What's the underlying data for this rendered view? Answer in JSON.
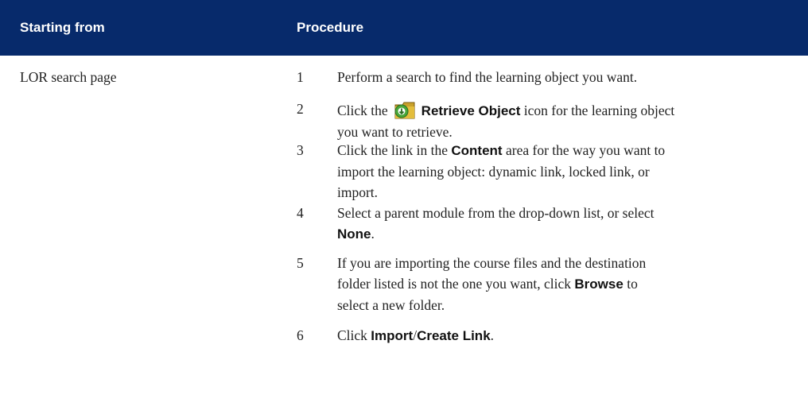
{
  "table": {
    "headers": {
      "starting_from": "Starting from",
      "procedure": "Procedure"
    },
    "row": {
      "starting_from": "LOR search page",
      "steps": [
        {
          "num": "1",
          "line1": "Perform a search to find the learning object you want."
        },
        {
          "num": "2",
          "pre": "Click the",
          "icon": "retrieve-object-icon",
          "ui": "Retrieve Object",
          "post": "icon  for the learning object",
          "line2": "you want to retrieve."
        },
        {
          "num": "3",
          "pre": "Click the link in the",
          "ui": "Content",
          "post": "area for the way you want to",
          "line2": "import the learning object: dynamic link, locked link, or",
          "line3": "import."
        },
        {
          "num": "4",
          "line1": "Select a parent module from the drop-down list, or select",
          "ui": "None",
          "post": "."
        },
        {
          "num": "5",
          "line1": "If you are importing the course files and the destination",
          "pre": "folder listed is not the one you want, click",
          "ui": "Browse",
          "post": "to",
          "line3": "select a new folder."
        },
        {
          "num": "6",
          "pre": "Click",
          "ui1": "Import",
          "slash": "/",
          "ui2": "Create Link",
          "post": "."
        }
      ]
    }
  },
  "colors": {
    "header_bg": "#072a6b",
    "header_text": "#ffffff",
    "body_text": "#222222"
  }
}
